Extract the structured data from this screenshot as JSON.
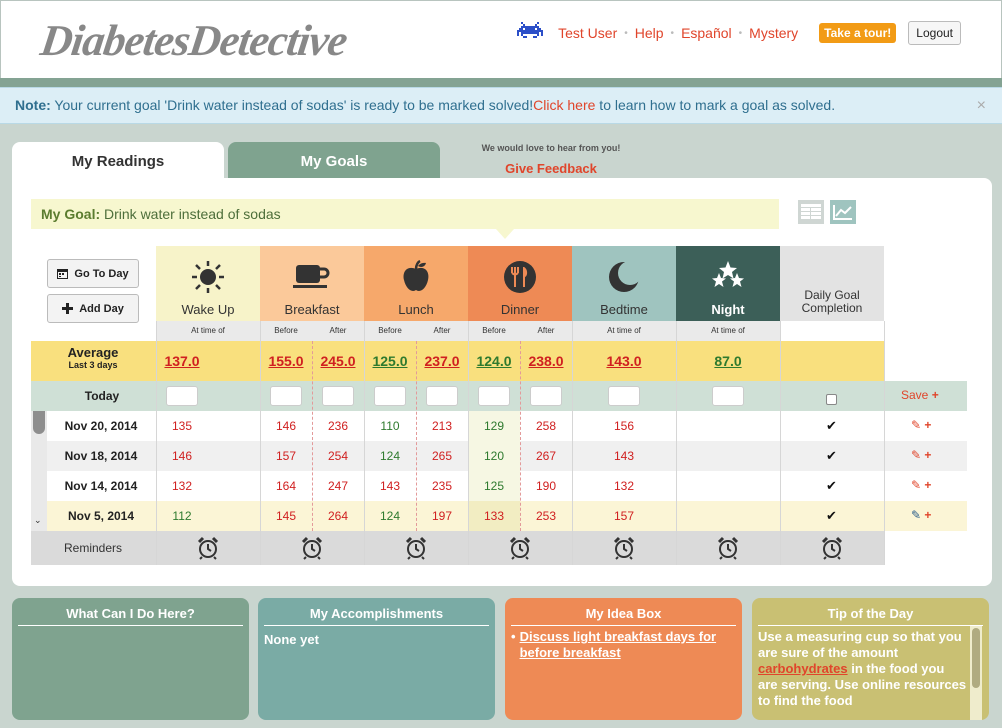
{
  "header": {
    "logo": "DiabetesDetective",
    "nav": [
      "Test User",
      "Help",
      "Español",
      "Mystery"
    ],
    "tour_button": "Take a tour!",
    "logout_button": "Logout"
  },
  "note": {
    "prefix": "Note:",
    "text": " Your current goal 'Drink water instead of sodas' is ready to be marked solved!",
    "link": "Click here",
    "suffix": " to learn how to mark a goal as solved.",
    "close": "×"
  },
  "tabs": {
    "readings": "My Readings",
    "goals": "My Goals"
  },
  "feedback": {
    "hint": "We would love to hear from you!",
    "link": "Give Feedback"
  },
  "goal": {
    "label": "My Goal:",
    "text": " Drink water instead of sodas"
  },
  "buttons": {
    "go_to_day": "Go To Day",
    "add_day": "Add Day"
  },
  "meals": [
    {
      "label": "Wake Up",
      "color": "#f7f3c9",
      "icon": "sun-icon"
    },
    {
      "label": "Breakfast",
      "color": "#fbc99a",
      "icon": "coffee-cup-icon"
    },
    {
      "label": "Lunch",
      "color": "#f6a86b",
      "icon": "apple-icon"
    },
    {
      "label": "Dinner",
      "color": "#ee8a55",
      "icon": "fork-knife-icon"
    },
    {
      "label": "Bedtime",
      "color": "#9fc4bf",
      "icon": "moon-icon"
    },
    {
      "label": "Night",
      "color": "#3c5f58",
      "icon": "stars-icon"
    },
    {
      "label": "Daily Goal Completion",
      "color": "#e3e3e3",
      "icon": ""
    }
  ],
  "subheaders": [
    "At time of",
    "Before",
    "After",
    "Before",
    "After",
    "Before",
    "After",
    "At time of",
    "At time of"
  ],
  "average": {
    "label": "Average",
    "sublabel": "Last 3 days",
    "values": [
      {
        "v": "137.0",
        "c": "#d02020"
      },
      {
        "v": "155.0",
        "c": "#d02020"
      },
      {
        "v": "245.0",
        "c": "#d02020"
      },
      {
        "v": "125.0",
        "c": "#2e7a2e"
      },
      {
        "v": "237.0",
        "c": "#d02020"
      },
      {
        "v": "124.0",
        "c": "#2e7a2e"
      },
      {
        "v": "238.0",
        "c": "#d02020"
      },
      {
        "v": "143.0",
        "c": "#d02020"
      },
      {
        "v": "87.0",
        "c": "#2e7a2e"
      }
    ]
  },
  "today": {
    "label": "Today",
    "save": "Save"
  },
  "rows": [
    {
      "date": "Nov 20, 2014",
      "values": [
        "135",
        "146",
        "236",
        "110",
        "213",
        "129",
        "258",
        "156",
        ""
      ],
      "colors": [
        "red",
        "red",
        "red",
        "green",
        "red",
        "green",
        "red",
        "red",
        ""
      ]
    },
    {
      "date": "Nov 18, 2014",
      "values": [
        "146",
        "157",
        "254",
        "124",
        "265",
        "120",
        "267",
        "143",
        ""
      ],
      "colors": [
        "red",
        "red",
        "red",
        "green",
        "red",
        "green",
        "red",
        "red",
        ""
      ]
    },
    {
      "date": "Nov 14, 2014",
      "values": [
        "132",
        "164",
        "247",
        "143",
        "235",
        "125",
        "190",
        "132",
        ""
      ],
      "colors": [
        "red",
        "red",
        "red",
        "red",
        "red",
        "green",
        "red",
        "red",
        ""
      ]
    },
    {
      "date": "Nov 5, 2014",
      "values": [
        "112",
        "145",
        "264",
        "124",
        "197",
        "133",
        "253",
        "157",
        ""
      ],
      "colors": [
        "green",
        "red",
        "red",
        "green",
        "red",
        "red",
        "red",
        "red",
        ""
      ]
    }
  ],
  "reminders": {
    "label": "Reminders"
  },
  "cards": {
    "what": {
      "title": "What Can I Do Here?"
    },
    "accomplishments": {
      "title": "My Accomplishments",
      "body": "None yet"
    },
    "idea": {
      "title": "My Idea Box",
      "item": "Discuss light breakfast days for before breakfast"
    },
    "tip": {
      "title": "Tip of the Day",
      "before": "Use a measuring cup so that you are sure of the amount ",
      "keyword": "carbohydrates",
      "after": " in the food you are serving. Use online resources to find the food"
    }
  }
}
